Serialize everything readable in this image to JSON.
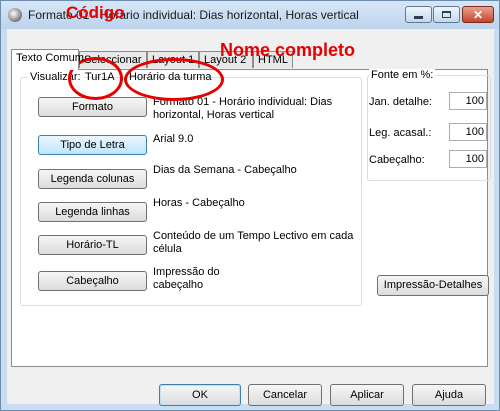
{
  "window": {
    "title": "Formato 01 - Horário individual: Dias horizontal, Horas vertical",
    "icons": {
      "app": "app-icon",
      "minimize": "minimize-icon",
      "maximize": "maximize-icon",
      "close": "close-icon"
    },
    "close_glyph": "✕"
  },
  "tabs": [
    {
      "label": "Texto Comum",
      "active": true
    },
    {
      "label": "Seleccionar",
      "active": false
    },
    {
      "label": "Layout 1",
      "active": false
    },
    {
      "label": "Layout 2",
      "active": false
    },
    {
      "label": "HTML",
      "active": false
    }
  ],
  "visualizar": {
    "label": "Visualizar:",
    "code": "Tur1A",
    "full_name": "Horário da turma"
  },
  "rows": [
    {
      "button": "Formato",
      "desc": "Formato 01 - Horário individual: Dias horizontal, Horas vertical"
    },
    {
      "button": "Tipo de Letra",
      "desc": "Arial 9.0"
    },
    {
      "button": "Legenda colunas",
      "desc": "Dias da Semana - Cabeçalho"
    },
    {
      "button": "Legenda linhas",
      "desc": "Horas - Cabeçalho"
    },
    {
      "button": "Horário-TL",
      "desc": "Conteúdo de um Tempo Lectivo em cada célula"
    },
    {
      "button": "Cabeçalho",
      "desc": "Impressão do cabeçalho"
    }
  ],
  "fonte": {
    "label": "Fonte em %:",
    "fields": [
      {
        "label": "Jan. detalhe:",
        "value": "100"
      },
      {
        "label": "Leg. acasal.:",
        "value": "100"
      },
      {
        "label": "Cabeçalho:",
        "value": "100"
      }
    ]
  },
  "impressao_button": "Impressão-Detalhes",
  "footer": {
    "ok": "OK",
    "cancel": "Cancelar",
    "apply": "Aplicar",
    "help": "Ajuda"
  },
  "annotations": {
    "code": "Código",
    "full_name": "Nome completo",
    "color": "#e60000"
  },
  "colors": {
    "titlebar": "#c9dcf0",
    "dialog_bg": "#f0f0f0",
    "panel_bg": "#ffffff",
    "focus_border": "#3c7fb1",
    "close_button": "#c9432b"
  }
}
